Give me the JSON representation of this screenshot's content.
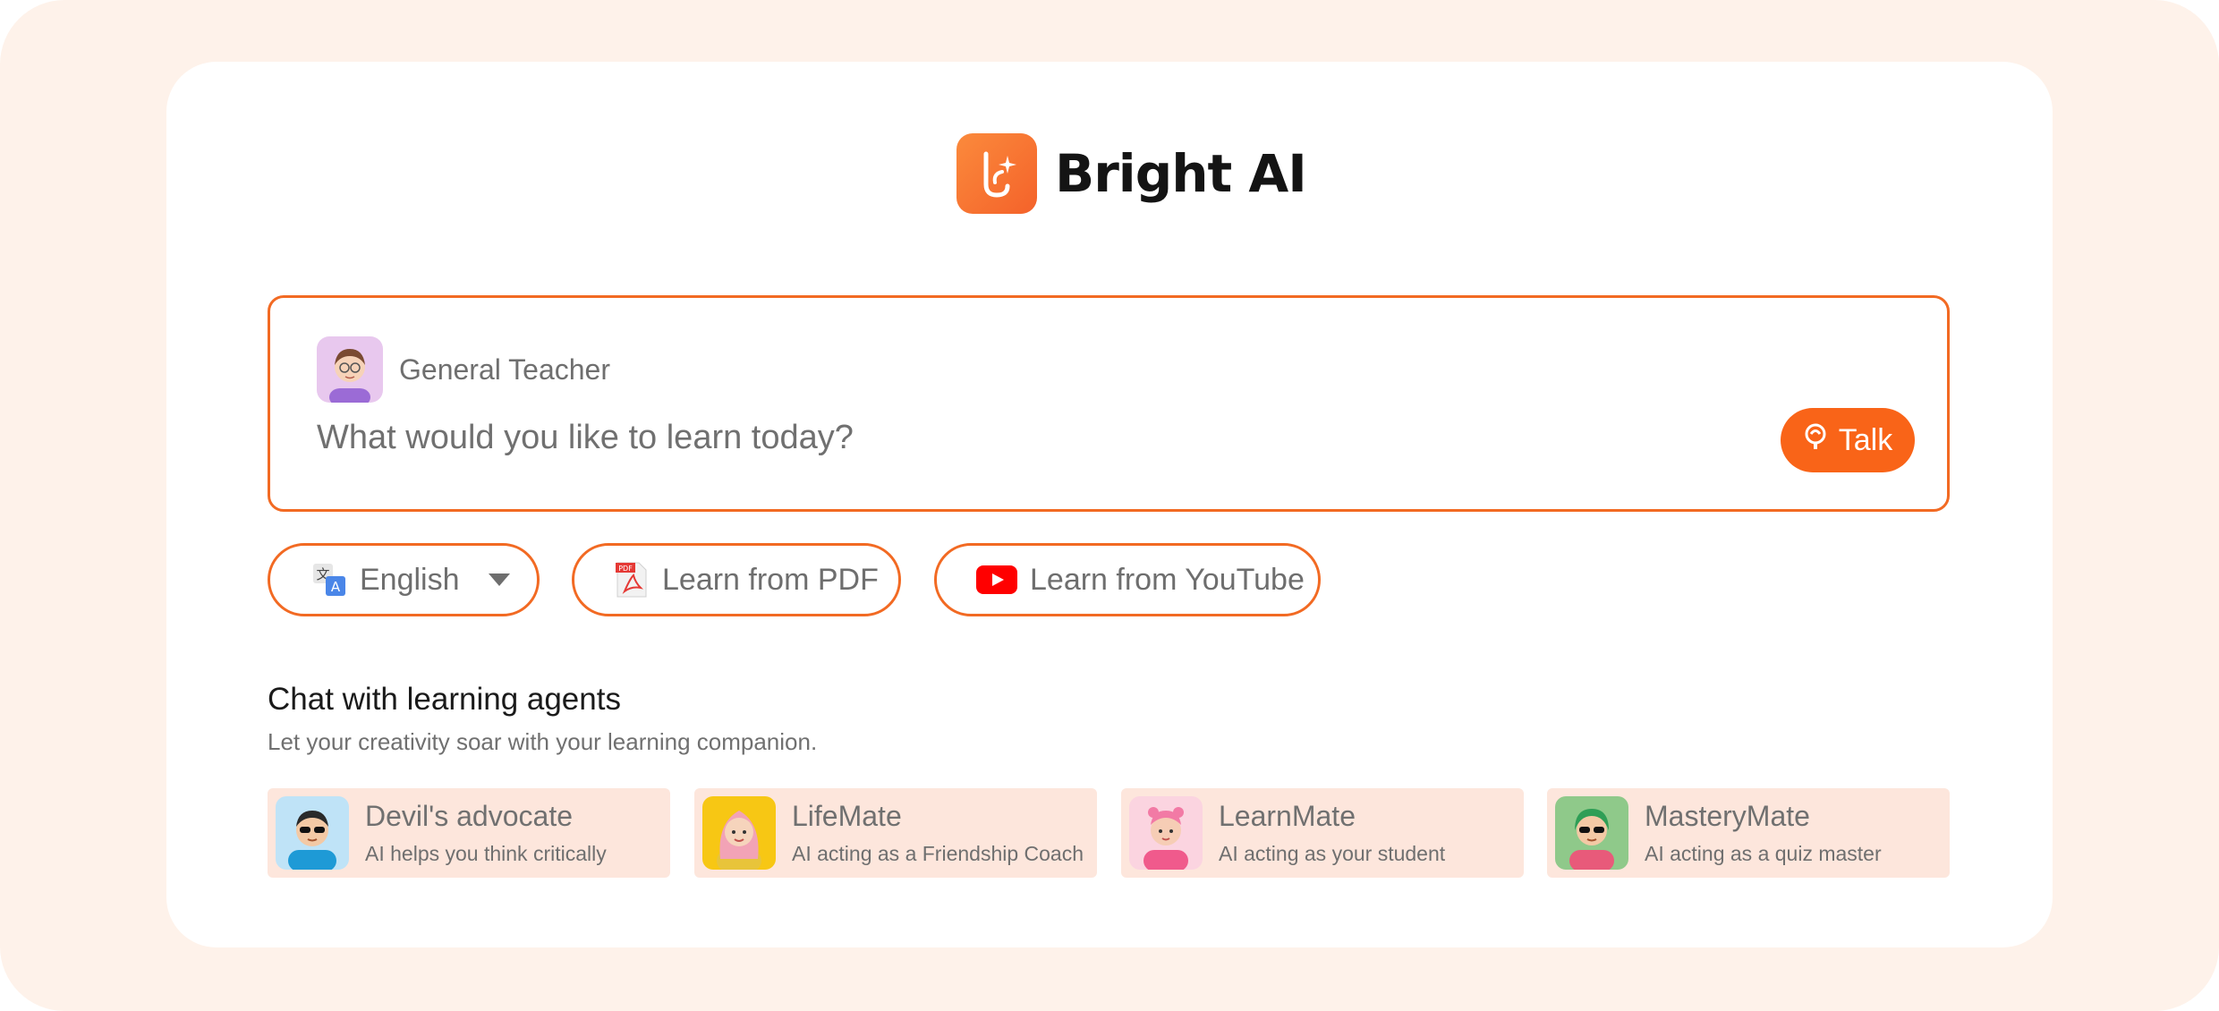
{
  "app": {
    "name": "Bright AI"
  },
  "prompt": {
    "agent_label": "General Teacher",
    "placeholder": "What would you like to learn today?",
    "talk_label": "Talk"
  },
  "options": {
    "language": {
      "selected": "English"
    },
    "pdf_label": "Learn from PDF",
    "youtube_label": "Learn from YouTube"
  },
  "agents_section": {
    "title": "Chat with learning agents",
    "subtitle": "Let your creativity soar with your learning companion.",
    "agents": [
      {
        "name": "Devil's advocate",
        "description": "AI helps you think critically"
      },
      {
        "name": "LifeMate",
        "description": "AI acting as a Friendship Coach"
      },
      {
        "name": "LearnMate",
        "description": "AI acting as your student"
      },
      {
        "name": "MasteryMate",
        "description": "AI acting as a quiz master"
      }
    ]
  },
  "colors": {
    "accent": "#f26a23",
    "background": "#fef2ea",
    "agent_card": "#fde6dc"
  }
}
